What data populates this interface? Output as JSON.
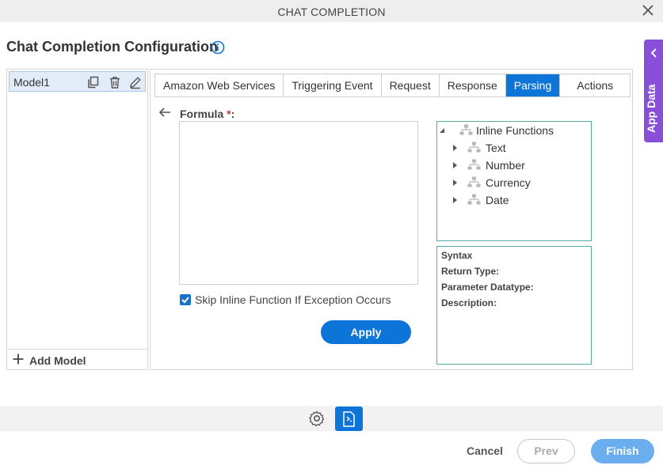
{
  "window": {
    "title": "CHAT COMPLETION",
    "close_icon": "close-icon"
  },
  "page": {
    "title": "Chat Completion Configuration",
    "info_icon": "info-icon"
  },
  "app_data_tab": {
    "label": "App Data",
    "icon": "chevron-left-icon",
    "color": "#8a4fd8"
  },
  "models": {
    "items": [
      {
        "name": "Model1",
        "selected": true
      }
    ],
    "add_label": "Add Model"
  },
  "tabs": [
    {
      "label": "Amazon Web Services",
      "active": false
    },
    {
      "label": "Triggering Event",
      "active": false
    },
    {
      "label": "Request",
      "active": false
    },
    {
      "label": "Response",
      "active": false
    },
    {
      "label": "Parsing",
      "active": true
    },
    {
      "label": "Actions",
      "active": false
    }
  ],
  "formula": {
    "label": "Formula",
    "required_marker": "*",
    "colon": ":",
    "value": "",
    "skip_label": "Skip Inline Function If Exception Occurs",
    "skip_checked": true,
    "apply_label": "Apply"
  },
  "inline_functions": {
    "root": "Inline Functions",
    "children": [
      "Text",
      "Number",
      "Currency",
      "Date"
    ]
  },
  "syntax": {
    "title": "Syntax",
    "return_type": "Return Type:",
    "parameter_datatype": "Parameter Datatype:",
    "description": "Description:"
  },
  "footer": {
    "cancel": "Cancel",
    "prev": "Prev",
    "finish": "Finish"
  },
  "colors": {
    "accent": "#0d74d8",
    "finish": "#6aaef0",
    "tree_border": "#55a8a8"
  }
}
